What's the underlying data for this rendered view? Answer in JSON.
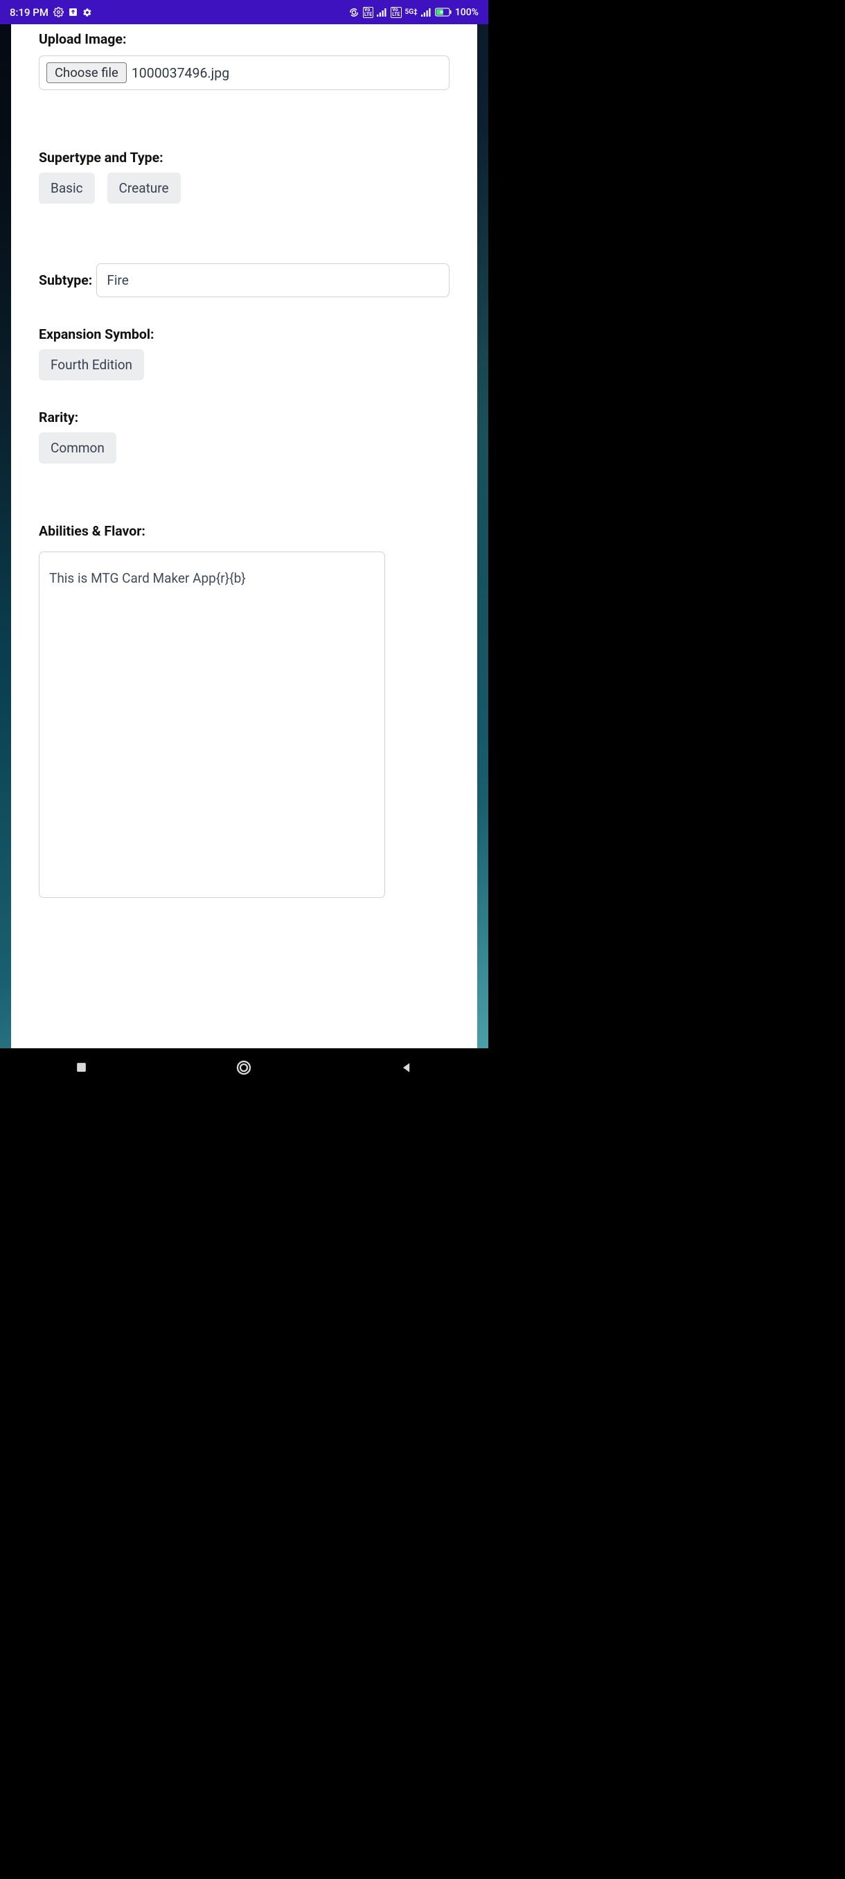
{
  "status": {
    "time": "8:19 PM",
    "battery": "100%",
    "net_label": "5G‡"
  },
  "upload": {
    "label": "Upload Image:",
    "button": "Choose file",
    "filename": "1000037496.jpg"
  },
  "supertype": {
    "label": "Supertype and Type:",
    "value1": "Basic",
    "value2": "Creature"
  },
  "subtype": {
    "label": "Subtype:",
    "value": "Fire"
  },
  "expansion": {
    "label": "Expansion Symbol:",
    "value": "Fourth Edition"
  },
  "rarity": {
    "label": "Rarity:",
    "value": "Common"
  },
  "abilities": {
    "label": "Abilities & Flavor:",
    "value": "This is MTG Card Maker App{r}{b}"
  }
}
